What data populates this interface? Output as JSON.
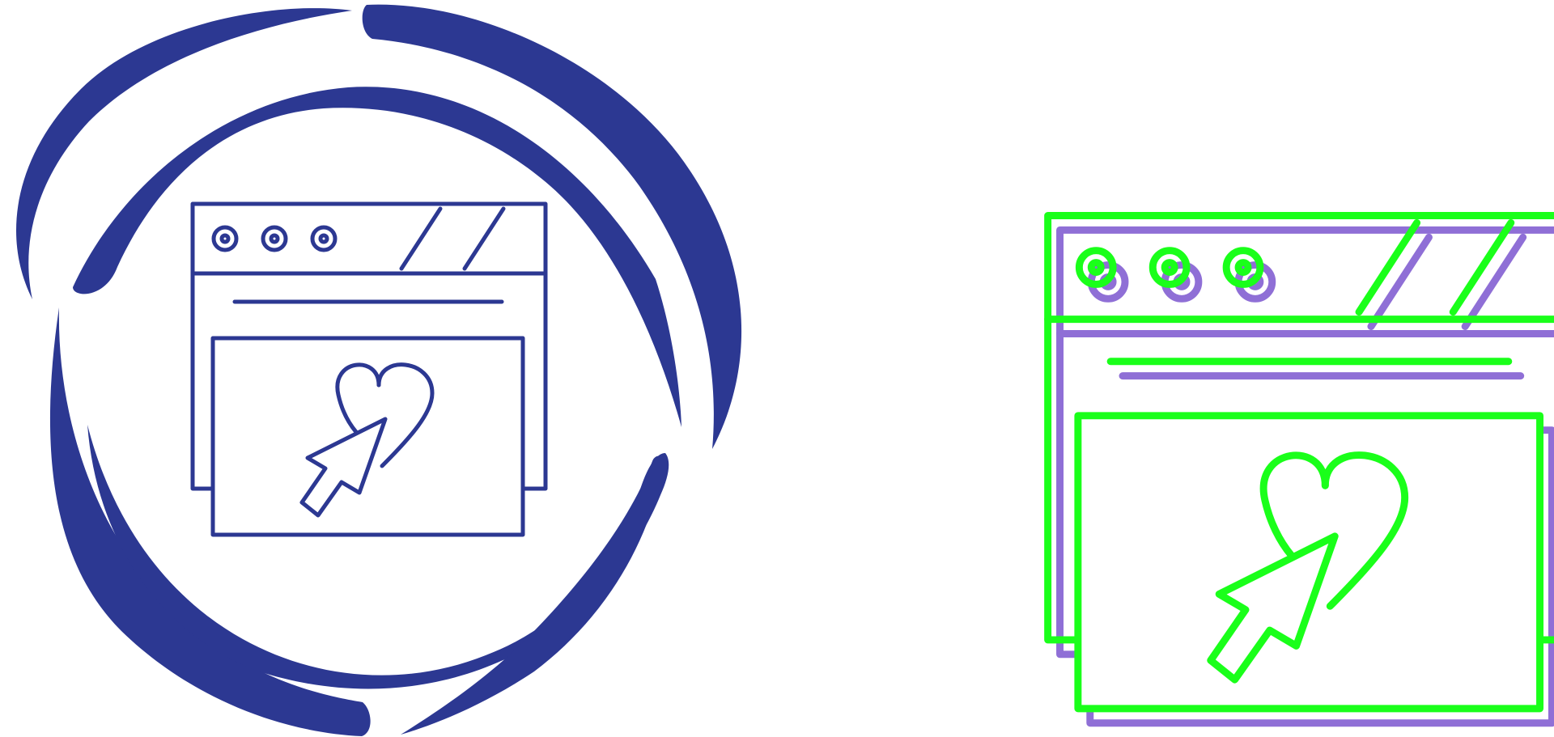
{
  "icons": [
    {
      "name": "favorite-webpage-icon-circular",
      "style": "glyph-outline-in-ring",
      "colors": {
        "primary": "#2c3892"
      }
    },
    {
      "name": "favorite-webpage-icon-offset",
      "style": "offset-outline",
      "colors": {
        "primary": "#1aff1a",
        "shadow": "#8f6fd6"
      }
    }
  ]
}
